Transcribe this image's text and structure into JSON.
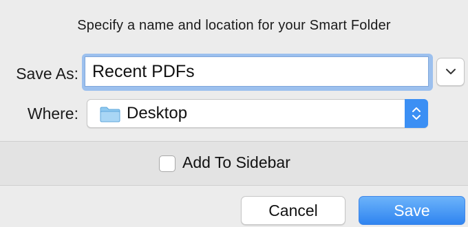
{
  "dialog": {
    "prompt": "Specify a name and location for your Smart Folder",
    "save_as_label": "Save As:",
    "save_as_value": "Recent PDFs",
    "expand_icon": "chevron-down-icon",
    "where_label": "Where:",
    "where_value": "Desktop",
    "where_icon": "folder-icon",
    "where_stepper_icon": "up-down-chevron-icon",
    "add_to_sidebar_label": "Add To Sidebar",
    "add_to_sidebar_checked": false,
    "cancel_label": "Cancel",
    "save_label": "Save"
  },
  "colors": {
    "accent": "#3b8ff4",
    "focus_ring": "#9cc0ee",
    "folder": "#8fc9f0"
  }
}
